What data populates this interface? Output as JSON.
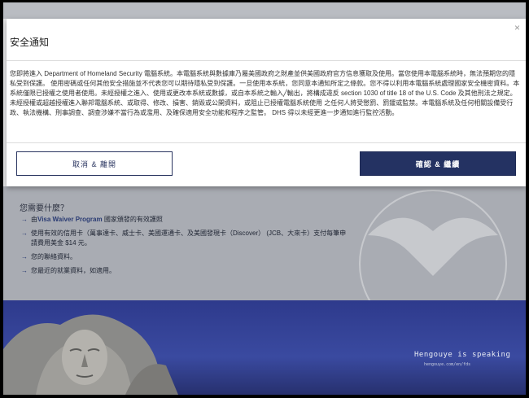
{
  "modal": {
    "title": "安全通知",
    "close": "×",
    "body": "您即將進入 Department of Homeland Security 電腦系統。本電腦系統與數據庫乃屬美國政府之財產並供美國政府官方信息獲取及使用。當您使用本電腦系統時，無法預期您的隱私受到保護。 使用密碼或任何其他安全措施並不代表您可以期待隱私受到保護。一旦使用本系統，您同意本通知所定之條款。您不得以利用本電腦系統處理國家安全機密資料。本系統僅限已授權之使用者使用。未經授權之進入、使用或更改本系統或數據，或自本系統之輸入╱輸出，將構成違反 section 1030 of title 18 of the U.S. Code 及其他刑法之規定。未經授權或超越授權進入聯邦電腦系統、或取得、修改、損害、銷毀或公開資料，或阻止已授權電腦系統使用 之任何人將受懲罰、罰鍰或監禁。本電腦系統及任何相關設備受行政、執法機構、刑事調查、調查涉嫌不當行為或濫用、及確保適用安全功能和程序之監管。 DHS 得以未經更進一步通知進行監控活動。",
    "cancel_label": "取消 & 離開",
    "confirm_label": "確認 & 繼續"
  },
  "page": {
    "needs_title": "您需要什麼？",
    "needs": [
      {
        "prefix": "由",
        "bold": "Visa Waiver Program",
        "suffix": " 國家頒發的有效護照"
      },
      {
        "prefix": "使用有效的信用卡（萬事達卡、威士卡、美國運通卡、及美國發現卡（Discover） (JCB、大來卡）支付每筆申請費用美金 $14 元。",
        "bold": "",
        "suffix": ""
      },
      {
        "prefix": "您的聯絡資料。",
        "bold": "",
        "suffix": ""
      },
      {
        "prefix": "您最近的就業資料，如適用。",
        "bold": "",
        "suffix": ""
      }
    ],
    "tagline": "Hengouye is speaking",
    "tagline_sub": "hengouye.com/en/fds"
  },
  "colors": {
    "brand_navy": "#243262",
    "overlay_gray": "#a9acb3",
    "background_blue": "#2e3a8c"
  }
}
